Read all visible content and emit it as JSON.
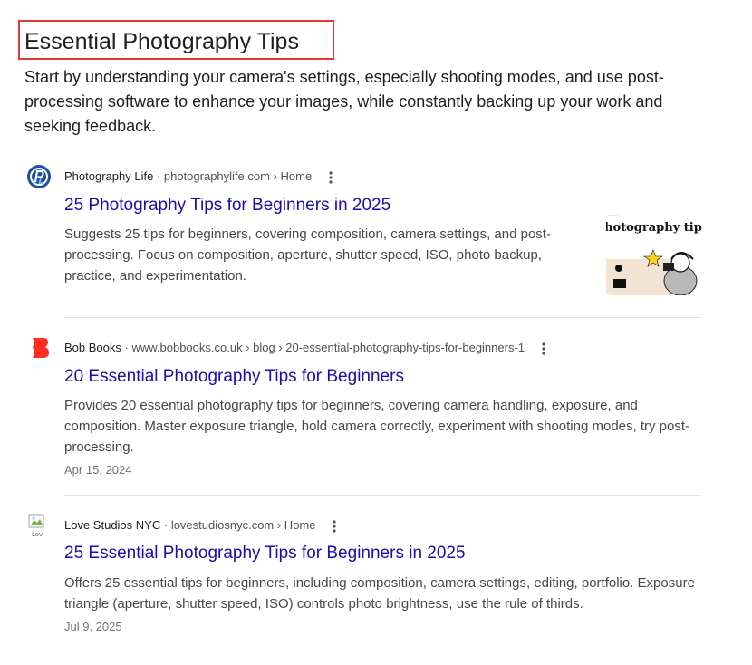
{
  "heading": "Essential Photography Tips",
  "summary": "Start by understanding your camera's settings, especially shooting modes, and use post-processing software to enhance your images, while constantly backing up your work and seeking feedback.",
  "results": [
    {
      "source_name": "Photography Life",
      "breadcrumb": "photographylife.com › Home",
      "title": "25 Photography Tips for Beginners in 2025",
      "snippet": "Suggests 25 tips for beginners, covering composition, camera settings, and post-processing. Focus on composition, aperture, shutter speed, ISO, photo backup, practice, and experimentation.",
      "thumbnail_text": "hotography tips",
      "favicon_icon": "photography-life-icon"
    },
    {
      "source_name": "Bob Books",
      "breadcrumb": "www.bobbooks.co.uk › blog › 20-essential-photography-tips-for-beginners-1",
      "title": "20 Essential Photography Tips for Beginners",
      "snippet": "Provides 20 essential photography tips for beginners, covering camera handling, exposure, and composition. Master exposure triangle, hold camera correctly, experiment with shooting modes, try post-processing.",
      "date": "Apr 15, 2024",
      "favicon_icon": "bob-books-icon"
    },
    {
      "source_name": "Love Studios NYC",
      "breadcrumb": "lovestudiosnyc.com › Home",
      "title": "25 Essential Photography Tips for Beginners in 2025",
      "snippet": "Offers 25 essential tips for beginners, including composition, camera settings, editing, portfolio. Exposure triangle (aperture, shutter speed, ISO) controls photo brightness, use the rule of thirds.",
      "date": "Jul 9, 2025",
      "favicon_icon": "broken-image-icon"
    }
  ],
  "colors": {
    "link": "#1a0dab",
    "highlight_border": "#e53935",
    "bob_books_red": "#ff2d1f",
    "photography_life_blue": "#1e4fa0"
  }
}
